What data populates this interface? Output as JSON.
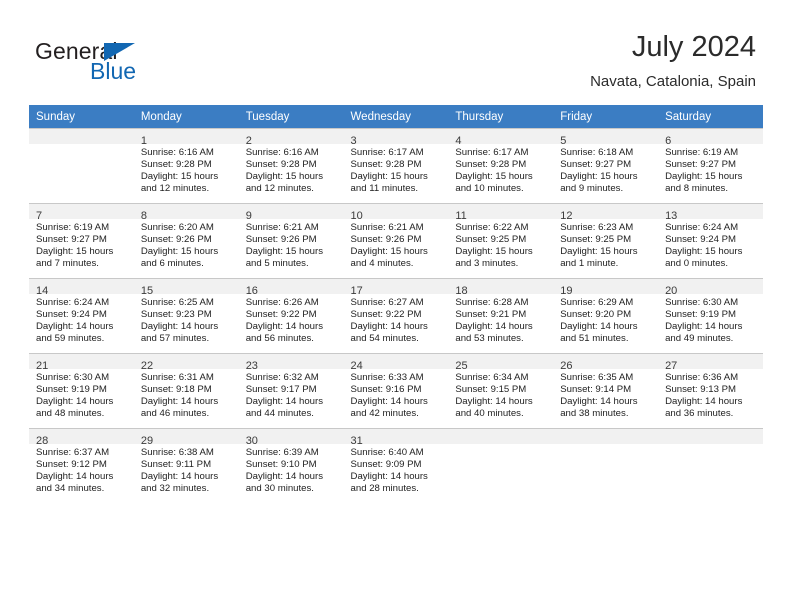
{
  "brand": {
    "name_top": "General",
    "name_bottom": "Blue",
    "accent_color": "#1267b2"
  },
  "header": {
    "title": "July 2024",
    "subtitle": "Navata, Catalonia, Spain"
  },
  "calendar": {
    "header_bg": "#3b7dc3",
    "daynum_bg": "#f1f1f1",
    "weekday_headers": [
      "Sunday",
      "Monday",
      "Tuesday",
      "Wednesday",
      "Thursday",
      "Friday",
      "Saturday"
    ],
    "weeks": [
      [
        {
          "day": "",
          "lines": []
        },
        {
          "day": "1",
          "lines": [
            "Sunrise: 6:16 AM",
            "Sunset: 9:28 PM",
            "Daylight: 15 hours",
            "and 12 minutes."
          ]
        },
        {
          "day": "2",
          "lines": [
            "Sunrise: 6:16 AM",
            "Sunset: 9:28 PM",
            "Daylight: 15 hours",
            "and 12 minutes."
          ]
        },
        {
          "day": "3",
          "lines": [
            "Sunrise: 6:17 AM",
            "Sunset: 9:28 PM",
            "Daylight: 15 hours",
            "and 11 minutes."
          ]
        },
        {
          "day": "4",
          "lines": [
            "Sunrise: 6:17 AM",
            "Sunset: 9:28 PM",
            "Daylight: 15 hours",
            "and 10 minutes."
          ]
        },
        {
          "day": "5",
          "lines": [
            "Sunrise: 6:18 AM",
            "Sunset: 9:27 PM",
            "Daylight: 15 hours",
            "and 9 minutes."
          ]
        },
        {
          "day": "6",
          "lines": [
            "Sunrise: 6:19 AM",
            "Sunset: 9:27 PM",
            "Daylight: 15 hours",
            "and 8 minutes."
          ]
        }
      ],
      [
        {
          "day": "7",
          "lines": [
            "Sunrise: 6:19 AM",
            "Sunset: 9:27 PM",
            "Daylight: 15 hours",
            "and 7 minutes."
          ]
        },
        {
          "day": "8",
          "lines": [
            "Sunrise: 6:20 AM",
            "Sunset: 9:26 PM",
            "Daylight: 15 hours",
            "and 6 minutes."
          ]
        },
        {
          "day": "9",
          "lines": [
            "Sunrise: 6:21 AM",
            "Sunset: 9:26 PM",
            "Daylight: 15 hours",
            "and 5 minutes."
          ]
        },
        {
          "day": "10",
          "lines": [
            "Sunrise: 6:21 AM",
            "Sunset: 9:26 PM",
            "Daylight: 15 hours",
            "and 4 minutes."
          ]
        },
        {
          "day": "11",
          "lines": [
            "Sunrise: 6:22 AM",
            "Sunset: 9:25 PM",
            "Daylight: 15 hours",
            "and 3 minutes."
          ]
        },
        {
          "day": "12",
          "lines": [
            "Sunrise: 6:23 AM",
            "Sunset: 9:25 PM",
            "Daylight: 15 hours",
            "and 1 minute."
          ]
        },
        {
          "day": "13",
          "lines": [
            "Sunrise: 6:24 AM",
            "Sunset: 9:24 PM",
            "Daylight: 15 hours",
            "and 0 minutes."
          ]
        }
      ],
      [
        {
          "day": "14",
          "lines": [
            "Sunrise: 6:24 AM",
            "Sunset: 9:24 PM",
            "Daylight: 14 hours",
            "and 59 minutes."
          ]
        },
        {
          "day": "15",
          "lines": [
            "Sunrise: 6:25 AM",
            "Sunset: 9:23 PM",
            "Daylight: 14 hours",
            "and 57 minutes."
          ]
        },
        {
          "day": "16",
          "lines": [
            "Sunrise: 6:26 AM",
            "Sunset: 9:22 PM",
            "Daylight: 14 hours",
            "and 56 minutes."
          ]
        },
        {
          "day": "17",
          "lines": [
            "Sunrise: 6:27 AM",
            "Sunset: 9:22 PM",
            "Daylight: 14 hours",
            "and 54 minutes."
          ]
        },
        {
          "day": "18",
          "lines": [
            "Sunrise: 6:28 AM",
            "Sunset: 9:21 PM",
            "Daylight: 14 hours",
            "and 53 minutes."
          ]
        },
        {
          "day": "19",
          "lines": [
            "Sunrise: 6:29 AM",
            "Sunset: 9:20 PM",
            "Daylight: 14 hours",
            "and 51 minutes."
          ]
        },
        {
          "day": "20",
          "lines": [
            "Sunrise: 6:30 AM",
            "Sunset: 9:19 PM",
            "Daylight: 14 hours",
            "and 49 minutes."
          ]
        }
      ],
      [
        {
          "day": "21",
          "lines": [
            "Sunrise: 6:30 AM",
            "Sunset: 9:19 PM",
            "Daylight: 14 hours",
            "and 48 minutes."
          ]
        },
        {
          "day": "22",
          "lines": [
            "Sunrise: 6:31 AM",
            "Sunset: 9:18 PM",
            "Daylight: 14 hours",
            "and 46 minutes."
          ]
        },
        {
          "day": "23",
          "lines": [
            "Sunrise: 6:32 AM",
            "Sunset: 9:17 PM",
            "Daylight: 14 hours",
            "and 44 minutes."
          ]
        },
        {
          "day": "24",
          "lines": [
            "Sunrise: 6:33 AM",
            "Sunset: 9:16 PM",
            "Daylight: 14 hours",
            "and 42 minutes."
          ]
        },
        {
          "day": "25",
          "lines": [
            "Sunrise: 6:34 AM",
            "Sunset: 9:15 PM",
            "Daylight: 14 hours",
            "and 40 minutes."
          ]
        },
        {
          "day": "26",
          "lines": [
            "Sunrise: 6:35 AM",
            "Sunset: 9:14 PM",
            "Daylight: 14 hours",
            "and 38 minutes."
          ]
        },
        {
          "day": "27",
          "lines": [
            "Sunrise: 6:36 AM",
            "Sunset: 9:13 PM",
            "Daylight: 14 hours",
            "and 36 minutes."
          ]
        }
      ],
      [
        {
          "day": "28",
          "lines": [
            "Sunrise: 6:37 AM",
            "Sunset: 9:12 PM",
            "Daylight: 14 hours",
            "and 34 minutes."
          ]
        },
        {
          "day": "29",
          "lines": [
            "Sunrise: 6:38 AM",
            "Sunset: 9:11 PM",
            "Daylight: 14 hours",
            "and 32 minutes."
          ]
        },
        {
          "day": "30",
          "lines": [
            "Sunrise: 6:39 AM",
            "Sunset: 9:10 PM",
            "Daylight: 14 hours",
            "and 30 minutes."
          ]
        },
        {
          "day": "31",
          "lines": [
            "Sunrise: 6:40 AM",
            "Sunset: 9:09 PM",
            "Daylight: 14 hours",
            "and 28 minutes."
          ]
        },
        {
          "day": "",
          "lines": []
        },
        {
          "day": "",
          "lines": []
        },
        {
          "day": "",
          "lines": []
        }
      ]
    ]
  }
}
